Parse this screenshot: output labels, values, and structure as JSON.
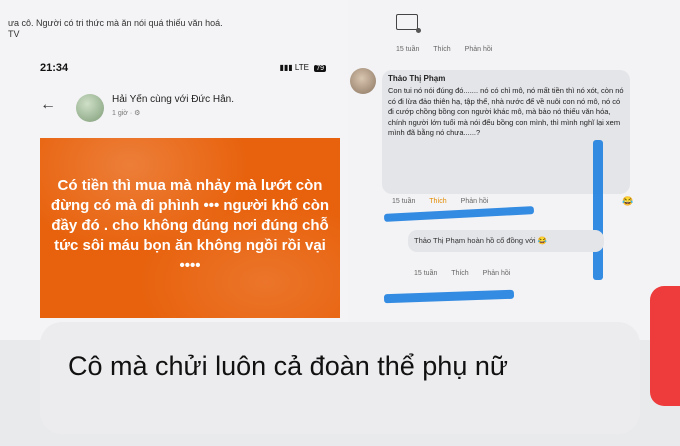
{
  "left_screenshot": {
    "top_caption": "ưa cô. Người có tri thức mà ăn nói quá thiếu văn hoá.\nTV",
    "status_time": "21:34",
    "status_network": "LTE",
    "status_battery": "79",
    "post": {
      "poster": "Hải Yến cùng với Đức Hân.",
      "meta": "1 giờ · ⚙"
    },
    "card_text": "Có tiền thì mua mà nhảy mà lướt còn đừng có mà đi phình ••• người khổ còn đầy đó . cho không đúng nơi đúng chỗ tức sôi máu bọn ăn không ngồi rồi vại ••••"
  },
  "right_screenshot": {
    "top_meta": {
      "time": "15 tuần",
      "like": "Thích",
      "reply": "Phản hồi"
    },
    "comment": {
      "author": "Thảo Thị Phạm",
      "text": "Con tui nó nói đúng đó....... nó có chỉ mô, nó mất tiền thì nó xót, còn nó có đi lừa đảo thiên hạ, tập thể, nhà nước để về nuôi con nó mô, nó có đi cướp chồng bồng con người khác mô, mà bảo nó thiếu văn hóa, chính người lớn tuổi mà nói đểu bồng con mình, thì mình nghĩ lại xem mình đã bằng nó chưa......?",
      "meta": {
        "time": "15 tuần",
        "like": "Thích",
        "reply": "Phản hồi"
      }
    },
    "reply": {
      "text": "Thảo Thị Phạm hoàn hồ cổ đồng với 😂",
      "meta": {
        "time": "15 tuần",
        "like": "Thích",
        "reply": "Phản hồi"
      }
    }
  },
  "caption": "Cô mà chửi luôn cả đoàn thể phụ nữ",
  "colors": {
    "orange_card": "#e8620d",
    "scribble_blue": "#1f7fe0",
    "red_mark": "#ee3c3c"
  }
}
